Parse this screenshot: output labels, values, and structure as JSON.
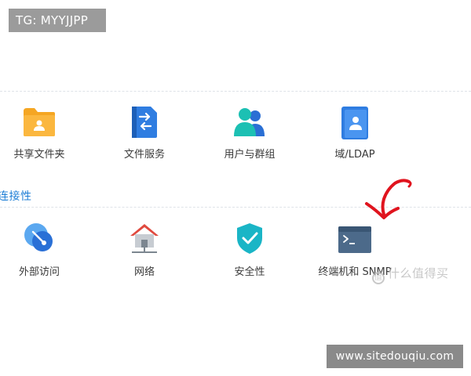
{
  "watermark_top": "TG: MYYJJPP",
  "section_connectivity": "连接性",
  "row1": [
    {
      "label": "共享文件夹",
      "icon": "shared-folder-icon"
    },
    {
      "label": "文件服务",
      "icon": "file-services-icon"
    },
    {
      "label": "用户与群组",
      "icon": "user-group-icon"
    },
    {
      "label": "域/LDAP",
      "icon": "domain-ldap-icon"
    }
  ],
  "row2": [
    {
      "label": "外部访问",
      "icon": "external-access-icon"
    },
    {
      "label": "网络",
      "icon": "network-icon"
    },
    {
      "label": "安全性",
      "icon": "security-shield-icon"
    },
    {
      "label": "终端机和 SNMP",
      "icon": "terminal-icon"
    }
  ],
  "zhide_watermark": "什么值得买",
  "zhide_badge": "值",
  "watermark_bottom": "www.sitedouqiu.com",
  "colors": {
    "accent": "#1f7fd6",
    "folder": "#f5a623",
    "shield": "#1ab5c6",
    "arrow": "#e0141e"
  }
}
